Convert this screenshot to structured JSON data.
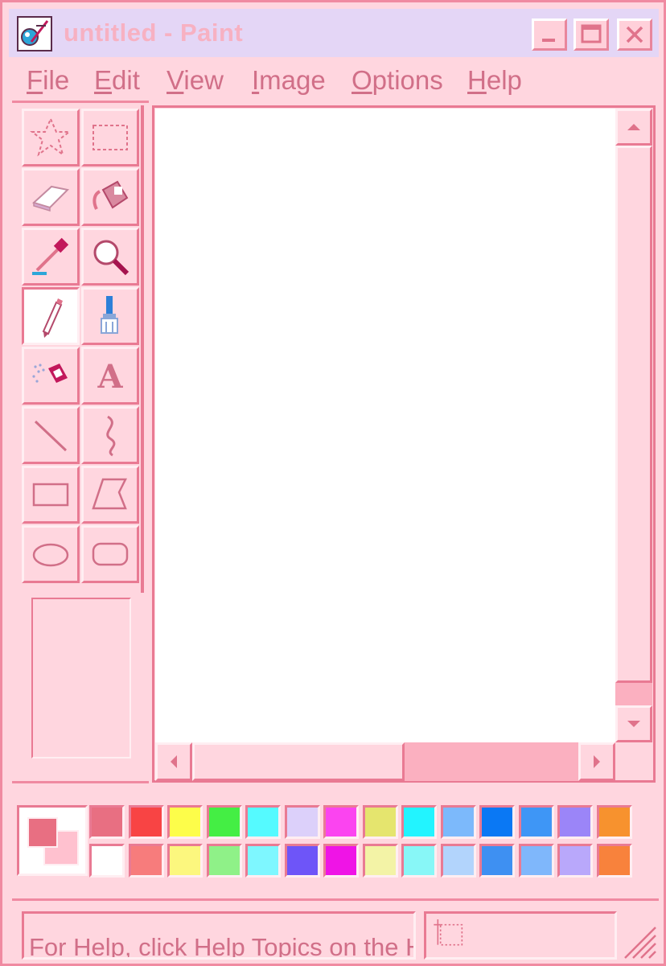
{
  "window": {
    "title": "untitled - Paint",
    "controls": {
      "minimize_icon": "minimize-icon",
      "maximize_icon": "maximize-icon",
      "close_icon": "close-icon"
    }
  },
  "menu": [
    {
      "label": "File",
      "mnemonic": "F",
      "rest": "ile"
    },
    {
      "label": "Edit",
      "mnemonic": "E",
      "rest": "dit"
    },
    {
      "label": "View",
      "mnemonic": "V",
      "rest": "iew"
    },
    {
      "label": "Image",
      "mnemonic": "I",
      "rest": "mage"
    },
    {
      "label": "Options",
      "mnemonic": "O",
      "rest": "ptions"
    },
    {
      "label": "Help",
      "mnemonic": "H",
      "rest": "elp"
    }
  ],
  "tools": [
    {
      "name": "free-form-select",
      "icon": "free-form-select-icon"
    },
    {
      "name": "rectangle-select",
      "icon": "rectangle-select-icon"
    },
    {
      "name": "eraser",
      "icon": "eraser-icon"
    },
    {
      "name": "fill",
      "icon": "fill-bucket-icon"
    },
    {
      "name": "pick-color",
      "icon": "eyedropper-icon"
    },
    {
      "name": "magnifier",
      "icon": "magnifier-icon"
    },
    {
      "name": "pencil",
      "icon": "pencil-icon",
      "selected": true
    },
    {
      "name": "brush",
      "icon": "brush-icon"
    },
    {
      "name": "airbrush",
      "icon": "airbrush-icon"
    },
    {
      "name": "text",
      "icon": "text-icon",
      "glyph": "A"
    },
    {
      "name": "line",
      "icon": "line-icon"
    },
    {
      "name": "curve",
      "icon": "curve-icon"
    },
    {
      "name": "rectangle",
      "icon": "rectangle-icon"
    },
    {
      "name": "polygon",
      "icon": "polygon-icon"
    },
    {
      "name": "ellipse",
      "icon": "ellipse-icon"
    },
    {
      "name": "rounded-rectangle",
      "icon": "rounded-rectangle-icon"
    }
  ],
  "colors": {
    "foreground": "#e86f82",
    "background": "#ffc1cf",
    "palette_top": [
      "#e86f82",
      "#f84444",
      "#fdfd4a",
      "#44ee44",
      "#55faff",
      "#dcd0fa",
      "#fb44f0",
      "#e5e56e",
      "#22f4ff",
      "#7cb9fb",
      "#0a78f4",
      "#3e96f6",
      "#9b85f8",
      "#f7922e"
    ],
    "palette_bottom": [
      "#ffffff",
      "#f77c7c",
      "#fcf77e",
      "#8ff188",
      "#7ef7ff",
      "#6e55f8",
      "#ef14e6",
      "#f3f3a6",
      "#88f7f7",
      "#b2d4fc",
      "#3e90f2",
      "#7fb7fb",
      "#b9a8fb",
      "#f8823c"
    ]
  },
  "status": {
    "help_text": "For Help, click Help Topics on the Help Menu.",
    "position_icon": "selection-size-icon",
    "grip_icon": "resize-grip-icon"
  },
  "scroll": {
    "up_icon": "scroll-up-icon",
    "down_icon": "scroll-down-icon",
    "left_icon": "scroll-left-icon",
    "right_icon": "scroll-right-icon"
  }
}
